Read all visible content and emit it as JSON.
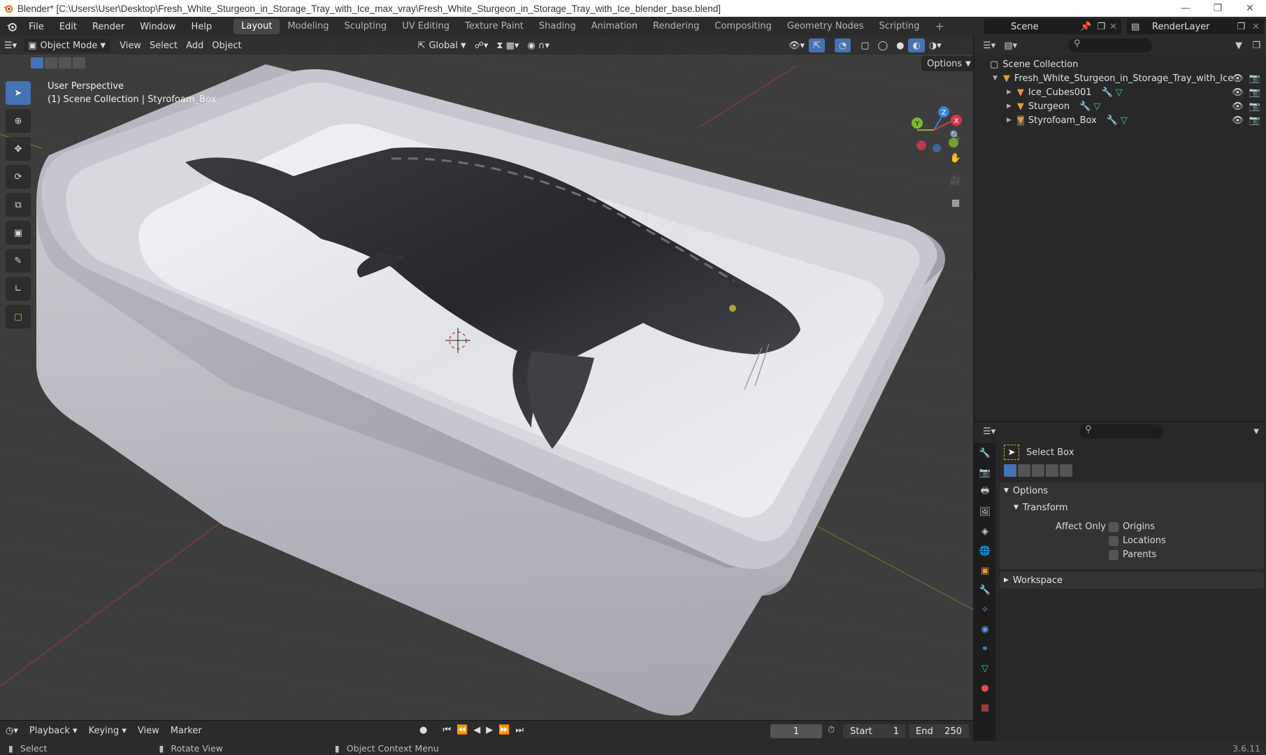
{
  "window": {
    "title": "Blender* [C:\\Users\\User\\Desktop\\Fresh_White_Sturgeon_in_Storage_Tray_with_Ice_max_vray\\Fresh_White_Sturgeon_in_Storage_Tray_with_Ice_blender_base.blend]"
  },
  "menu": [
    "File",
    "Edit",
    "Render",
    "Window",
    "Help"
  ],
  "workspaces": [
    "Layout",
    "Modeling",
    "Sculpting",
    "UV Editing",
    "Texture Paint",
    "Shading",
    "Animation",
    "Rendering",
    "Compositing",
    "Geometry Nodes",
    "Scripting"
  ],
  "active_workspace": "Layout",
  "scene": {
    "name": "Scene",
    "render_layer": "RenderLayer"
  },
  "viewport": {
    "mode": "Object Mode",
    "menus": [
      "View",
      "Select",
      "Add",
      "Object"
    ],
    "orientation": "Global",
    "options_label": "Options",
    "perspective": "User Perspective",
    "collection_info": "(1) Scene Collection | Styrofoam_Box",
    "gizmo_axes": {
      "x": "X",
      "y": "Y",
      "z": "Z"
    }
  },
  "outliner": {
    "root": "Scene Collection",
    "collection": "Fresh_White_Sturgeon_in_Storage_Tray_with_Ice",
    "objects": [
      "Ice_Cubes001",
      "Sturgeon",
      "Styrofoam_Box"
    ]
  },
  "properties": {
    "tool_name": "Select Box",
    "options_label": "Options",
    "transform_label": "Transform",
    "affect_only_label": "Affect Only",
    "affect_options": [
      "Origins",
      "Locations",
      "Parents"
    ],
    "workspace_label": "Workspace"
  },
  "timeline": {
    "menus": [
      "Playback",
      "Keying",
      "View",
      "Marker"
    ],
    "current_frame": "1",
    "start_label": "Start",
    "start": "1",
    "end_label": "End",
    "end": "250"
  },
  "statusbar": {
    "select": "Select",
    "rotate": "Rotate View",
    "context": "Object Context Menu",
    "version": "3.6.11"
  },
  "colors": {
    "accent": "#4772b3",
    "x_axis": "#d43a4f",
    "y_axis": "#7fb82f",
    "z_axis": "#3f7fd8"
  }
}
